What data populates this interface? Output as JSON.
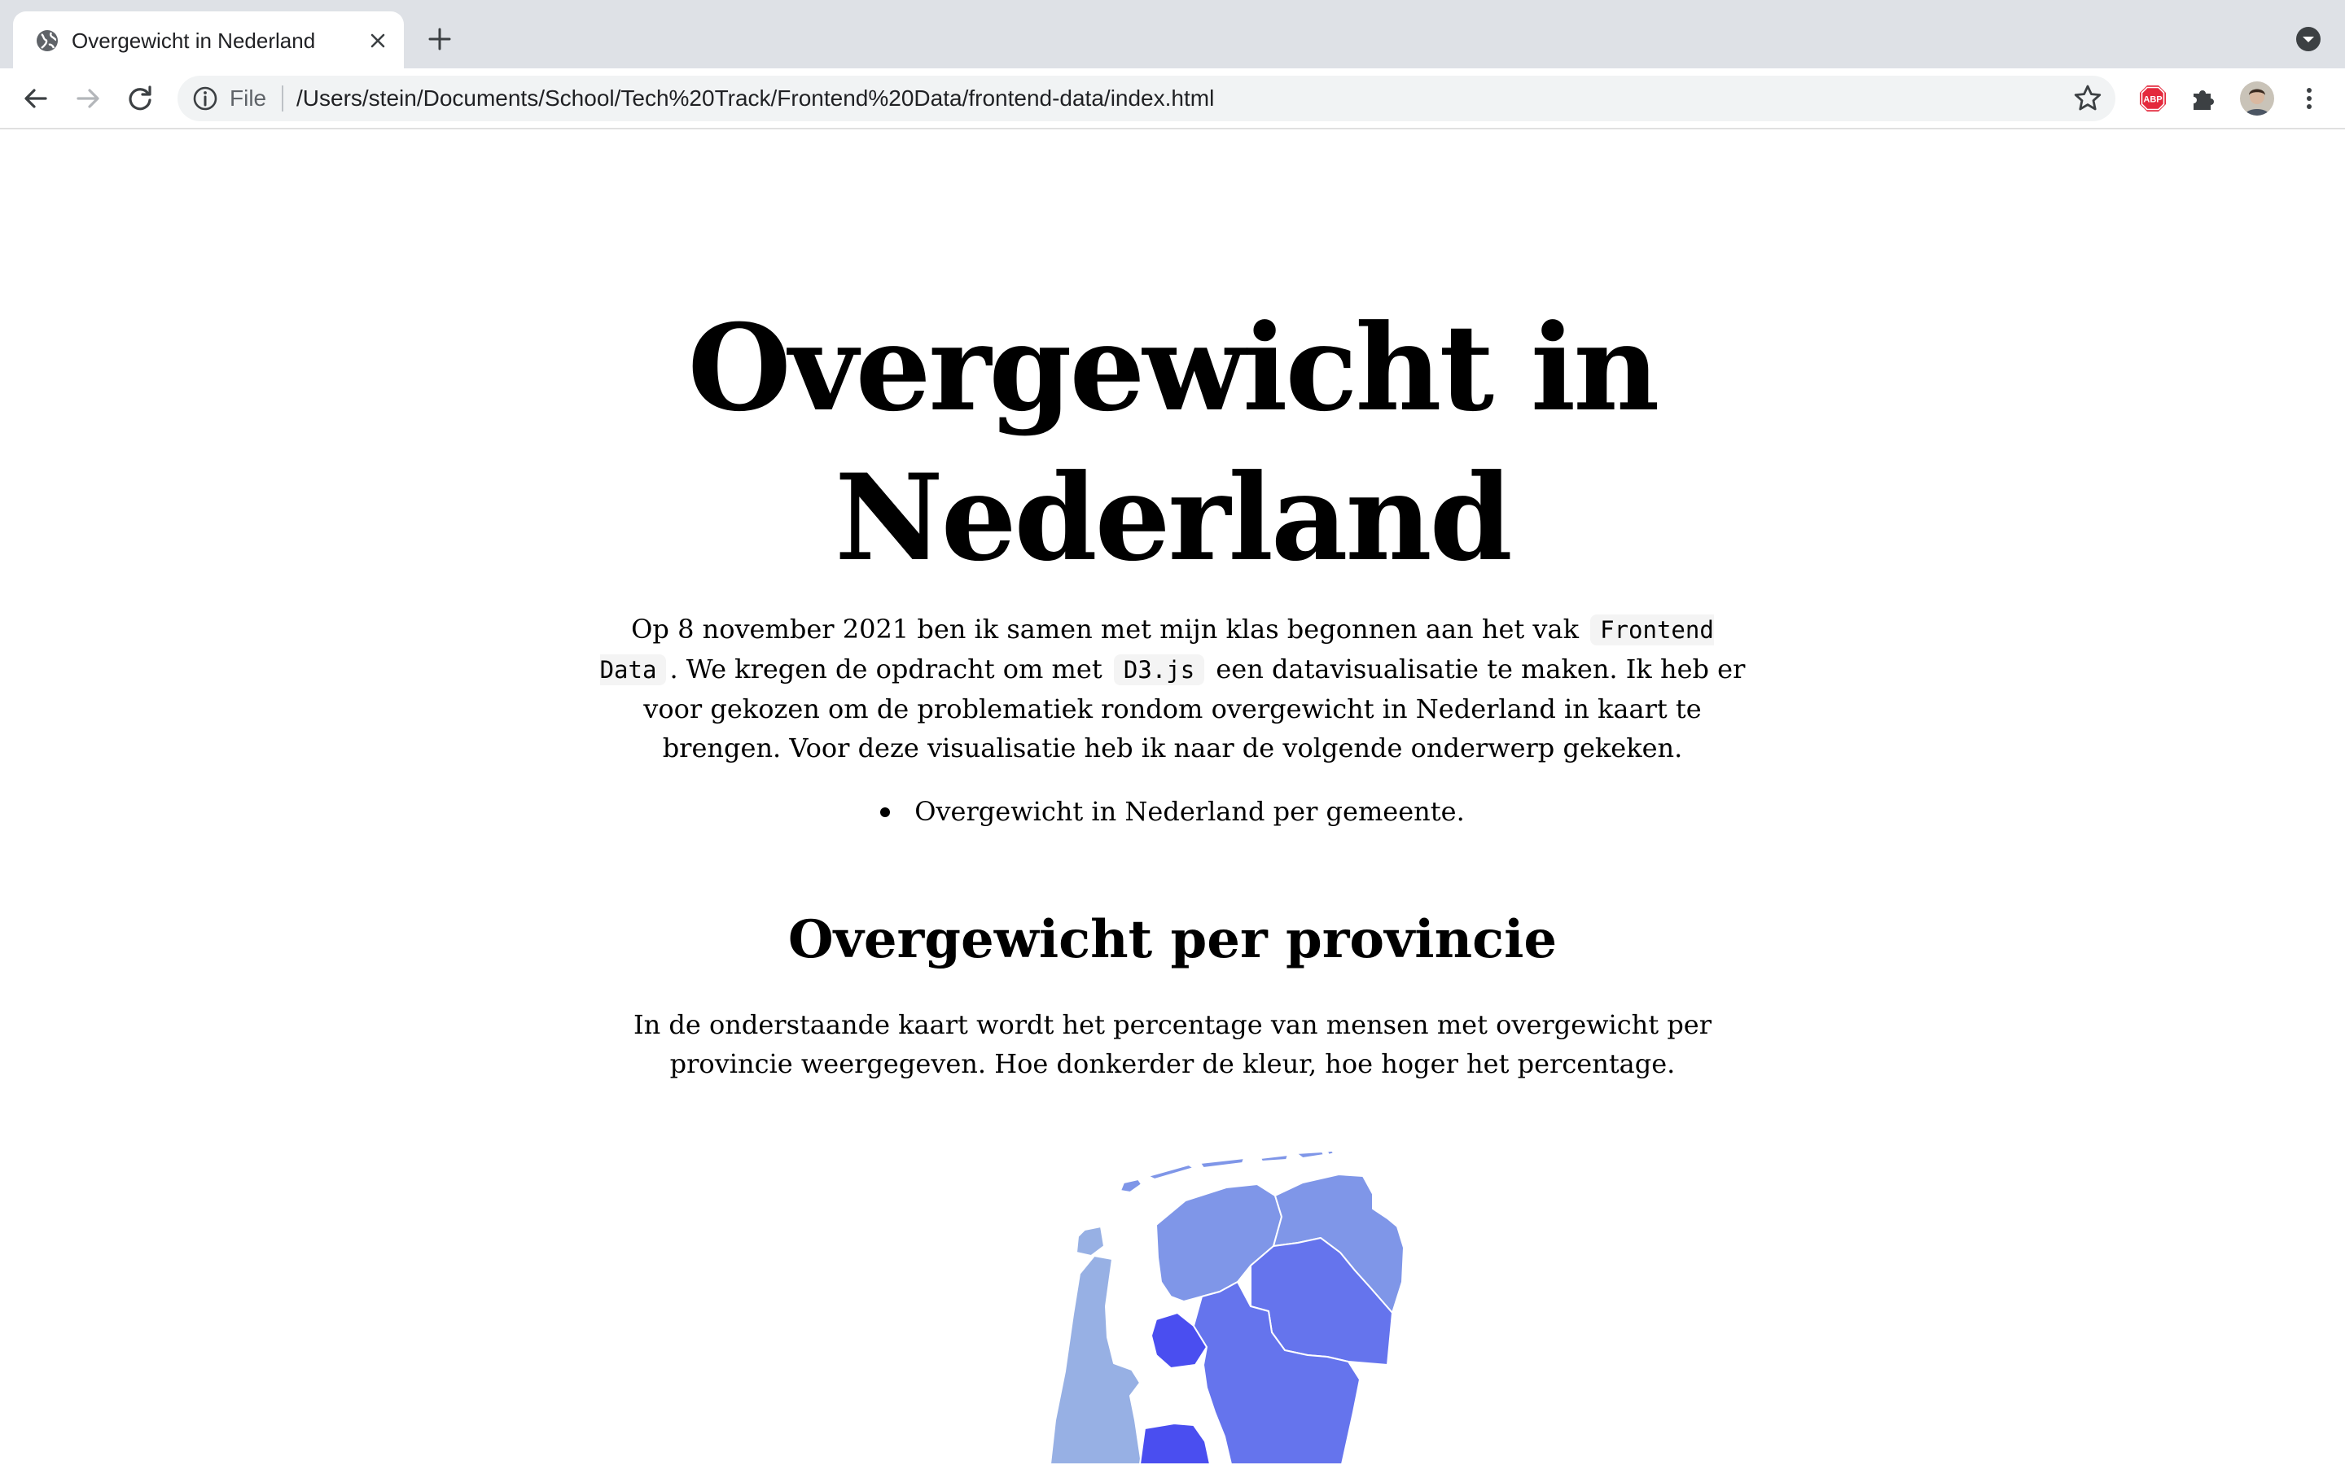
{
  "browser": {
    "tab_title": "Overgewicht in Nederland",
    "scheme": "File",
    "url": "/Users/stein/Documents/School/Tech%20Track/Frontend%20Data/frontend-data/index.html",
    "icons": {
      "favicon": "globe-icon",
      "close": "close-icon",
      "new_tab": "plus-icon",
      "back": "arrow-left-icon",
      "forward": "arrow-right-icon",
      "reload": "reload-icon",
      "info": "info-icon",
      "bookmark": "star-icon",
      "adblock": "abp-icon",
      "extensions": "puzzle-icon",
      "profile": "avatar",
      "menu": "kebab-menu-icon",
      "tab_search": "chevron-down-icon"
    }
  },
  "page": {
    "title": "Overgewicht in Nederland",
    "intro": {
      "part1": "Op 8 november 2021 ben ik samen met mijn klas begonnen aan het vak",
      "code1": "Frontend Data",
      "part2": ". We kregen de opdracht om met",
      "code2": "D3.js",
      "part3": "een datavisualisatie te maken. Ik heb er voor gekozen om de problematiek rondom overgewicht in Nederland in kaart te brengen. Voor deze visualisatie heb ik naar de volgende onderwerp gekeken."
    },
    "topics": [
      "Overgewicht in Nederland per gemeente."
    ],
    "section": {
      "title": "Overgewicht per provincie",
      "text": "In de onderstaande kaart wordt het percentage van mensen met overgewicht per provincie weergegeven. Hoe donkerder de kleur, hoe hoger het percentage."
    },
    "map": {
      "colors": {
        "light": "#97b0e4",
        "medium": "#7f96e8",
        "dark": "#6574ed",
        "darkest": "#4a4ef0"
      }
    }
  }
}
